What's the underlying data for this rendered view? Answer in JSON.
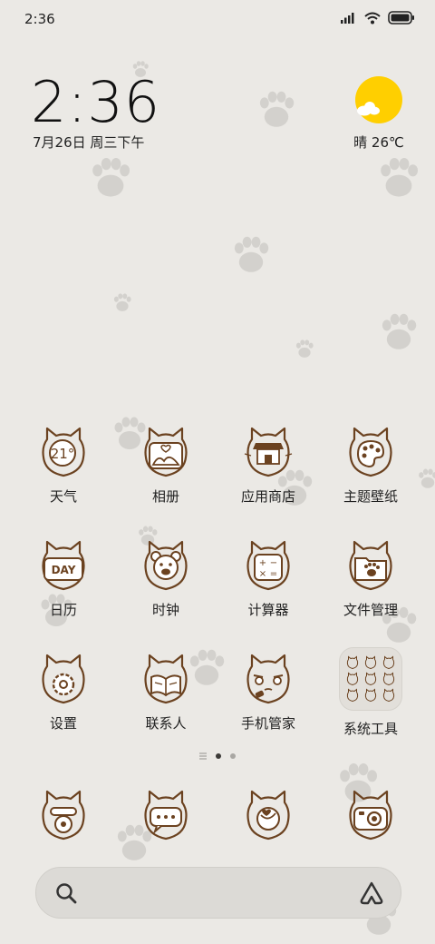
{
  "status": {
    "time": "2:36"
  },
  "clock": {
    "time": "2:36",
    "date": "7月26日 周三下午"
  },
  "weather": {
    "text": "晴 26℃",
    "icon": "sun-cloud-icon"
  },
  "apps": [
    {
      "label": "天气",
      "icon": "weather-cat-icon",
      "badge": "21°"
    },
    {
      "label": "相册",
      "icon": "gallery-cat-icon"
    },
    {
      "label": "应用商店",
      "icon": "store-cat-icon"
    },
    {
      "label": "主题壁纸",
      "icon": "palette-cat-icon"
    },
    {
      "label": "日历",
      "icon": "calendar-cat-icon",
      "badge": "DAY"
    },
    {
      "label": "时钟",
      "icon": "clock-bear-icon"
    },
    {
      "label": "计算器",
      "icon": "calculator-cat-icon"
    },
    {
      "label": "文件管理",
      "icon": "folder-cat-icon"
    },
    {
      "label": "设置",
      "icon": "settings-cat-icon"
    },
    {
      "label": "联系人",
      "icon": "contacts-cat-icon"
    },
    {
      "label": "手机管家",
      "icon": "security-cat-icon"
    },
    {
      "label": "系统工具",
      "icon": "system-tools-folder-icon"
    }
  ],
  "dock": [
    {
      "icon": "phone-cat-icon"
    },
    {
      "icon": "messages-cat-icon"
    },
    {
      "icon": "browser-cat-icon"
    },
    {
      "icon": "camera-cat-icon"
    }
  ],
  "pager": {
    "pages": 2,
    "active": 1
  },
  "colors": {
    "background": "#ebe9e5",
    "icon_stroke": "#6b4220",
    "sun": "#ffcf00"
  }
}
